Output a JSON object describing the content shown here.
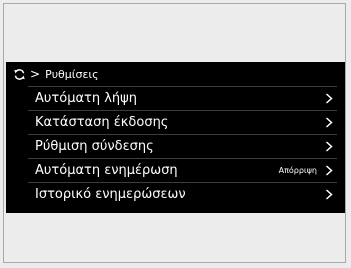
{
  "header": {
    "icon": "sync-icon",
    "separator": ">",
    "title": "Ρυθμίσεις"
  },
  "items": [
    {
      "label": "Αυτόματη λήψη",
      "value": ""
    },
    {
      "label": "Κατάσταση έκδοσης",
      "value": ""
    },
    {
      "label": "Ρύθμιση σύνδεσης",
      "value": ""
    },
    {
      "label": "Αυτόματη ενημέρωση",
      "value": "Απόρριψη"
    },
    {
      "label": "Ιστορικό ενημερώσεων",
      "value": ""
    }
  ],
  "colors": {
    "screen_background": "#000000",
    "text": "#ffffff",
    "divider": "#3d3d3d",
    "page_background": "#ececec"
  }
}
